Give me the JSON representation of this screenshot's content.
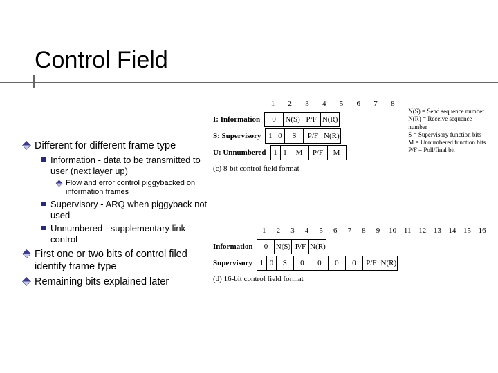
{
  "title": "Control Field",
  "bullets": {
    "b1": "Different for different frame type",
    "b1a": "Information - data to be transmitted to user (next layer up)",
    "b1a1": "Flow and error control piggybacked on information frames",
    "b1b": "Supervisory - ARQ when piggyback not used",
    "b1c": "Unnumbered - supplementary link control",
    "b2": "First one or two bits of control filed identify frame type",
    "b3": "Remaining bits explained later"
  },
  "fig8": {
    "row_i_label": "I: Information",
    "row_s_label": "S: Supervisory",
    "row_u_label": "U: Unnumbered",
    "caption": "(c) 8-bit control field format",
    "header": [
      "1",
      "2",
      "3",
      "4",
      "5",
      "6",
      "7",
      "8"
    ],
    "row_i": [
      "0",
      "N(S)",
      "P/F",
      "N(R)"
    ],
    "row_s": [
      "1",
      "0",
      "S",
      "P/F",
      "N(R)"
    ],
    "row_u": [
      "1",
      "1",
      "M",
      "P/F",
      "M"
    ],
    "legend": {
      "l1": "N(S) = Send sequence number",
      "l2": "N(R) = Receive sequence number",
      "l3": "S = Supervisory function bits",
      "l4": "M = Unnumbered function bits",
      "l5": "P/F = Poll/final bit"
    }
  },
  "fig16": {
    "row_i_label": "Information",
    "row_s_label": "Supervisory",
    "caption": "(d) 16-bit control field format",
    "header": [
      "1",
      "2",
      "3",
      "4",
      "5",
      "6",
      "7",
      "8",
      "9",
      "10",
      "11",
      "12",
      "13",
      "14",
      "15",
      "16"
    ],
    "row_i": [
      "0",
      "N(S)",
      "P/F",
      "N(R)"
    ],
    "row_s": [
      "1",
      "0",
      "S",
      "0",
      "0",
      "0",
      "0",
      "P/F",
      "N(R)"
    ]
  }
}
